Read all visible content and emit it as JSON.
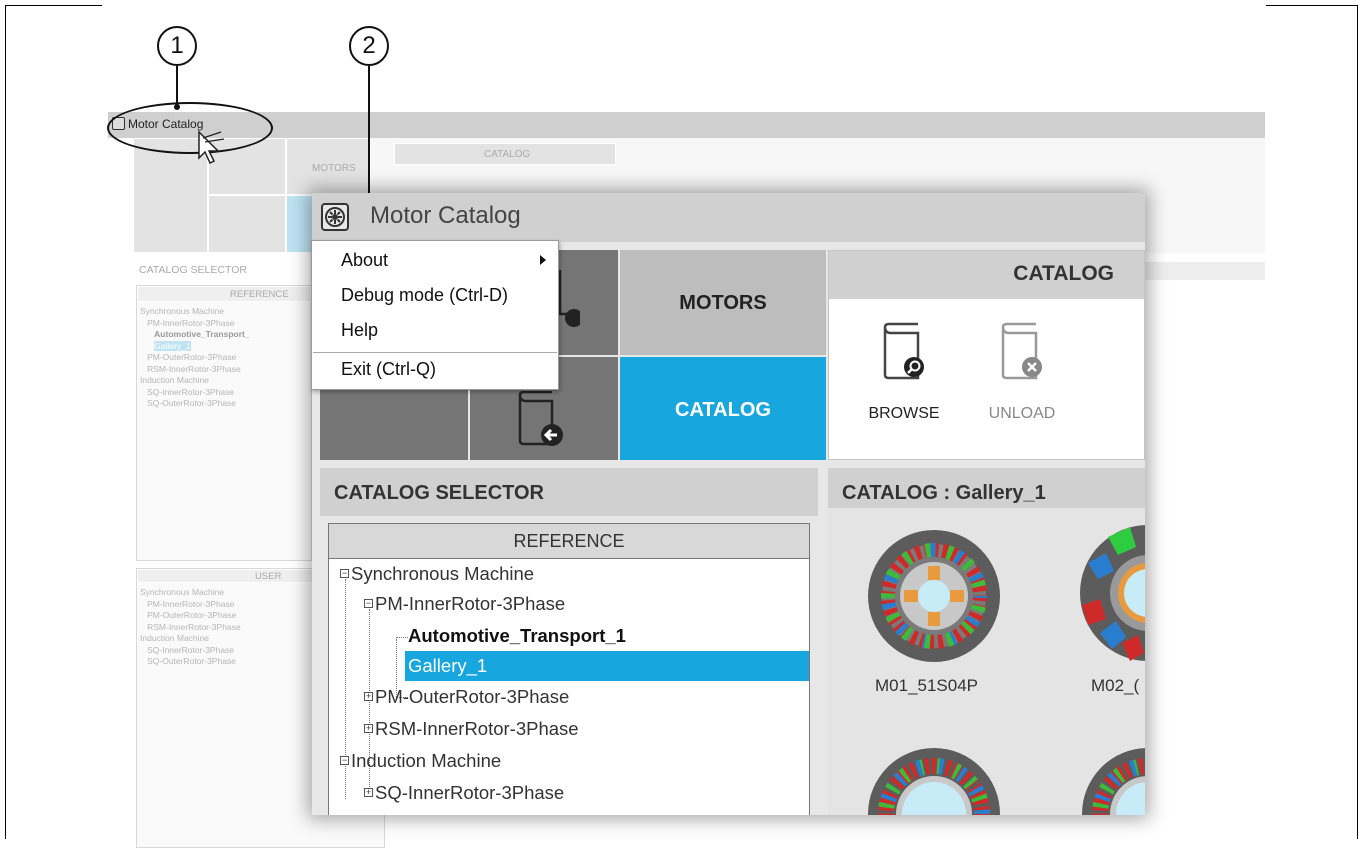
{
  "callouts": [
    "1",
    "2"
  ],
  "background_app": {
    "title": "Motor Catalog",
    "ribbon_motors_label": "MOTORS",
    "ribbon_catalog_label": "CATALOG",
    "catalog_selector_label": "CATALOG SELECTOR",
    "reference_label": "REFERENCE",
    "user_label": "USER",
    "reference_tree": [
      "Synchronous Machine",
      "PM-InnerRotor-3Phase",
      "Automotive_Transport_",
      "Gallery_1",
      "PM-OuterRotor-3Phase",
      "RSM-InnerRotor-3Phase",
      "Induction Machine",
      "SQ-InnerRotor-3Phase",
      "SQ-OuterRotor-3Phase"
    ],
    "user_tree": [
      "Synchronous Machine",
      "PM-InnerRotor-3Phase",
      "PM-OuterRotor-3Phase",
      "RSM-InnerRotor-3Phase",
      "Induction Machine",
      "SQ-InnerRotor-3Phase",
      "SQ-OuterRotor-3Phase"
    ]
  },
  "window": {
    "title": "Motor Catalog",
    "tiles": {
      "motors": "MOTORS",
      "catalog": "CATALOG"
    },
    "catalog_panel": {
      "header": "CATALOG",
      "browse": "BROWSE",
      "unload": "UNLOAD"
    },
    "catalog_selector": {
      "header": "CATALOG SELECTOR",
      "reference_header": "REFERENCE",
      "tree": [
        {
          "label": "Synchronous Machine"
        },
        {
          "label": "PM-InnerRotor-3Phase"
        },
        {
          "label": "Automotive_Transport_1"
        },
        {
          "label": "Gallery_1"
        },
        {
          "label": "PM-OuterRotor-3Phase"
        },
        {
          "label": "RSM-InnerRotor-3Phase"
        },
        {
          "label": "Induction Machine"
        },
        {
          "label": "SQ-InnerRotor-3Phase"
        }
      ]
    },
    "gallery": {
      "header": "CATALOG : Gallery_1",
      "motors": [
        {
          "label": "M01_51S04P"
        },
        {
          "label": "M02_("
        }
      ]
    }
  },
  "menu": {
    "items": [
      "About",
      "Debug mode (Ctrl-D)",
      "Help",
      "Exit (Ctrl-Q)"
    ]
  },
  "colors": {
    "accent_blue": "#17a6dd",
    "tile_dark": "#757575",
    "tile_light": "#bdbdbd",
    "header_gray": "#d0d0d0"
  },
  "icons": [
    "motor-catalog-icon",
    "mouse-cursor-icon",
    "submenu-arrow-icon",
    "browse-book-icon",
    "unload-book-icon",
    "tree-expand-icon",
    "tree-collapse-icon"
  ]
}
